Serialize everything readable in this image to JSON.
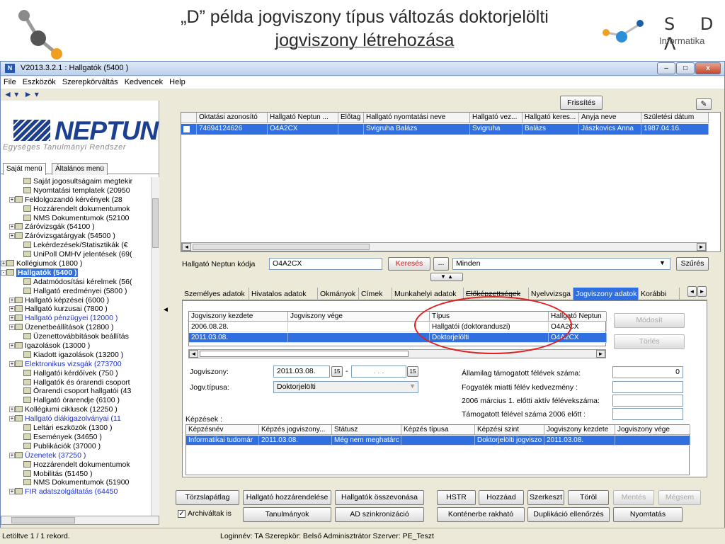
{
  "slide": {
    "title_line1": "„D” példa jogviszony típus változás doktorjelölti",
    "title_line2": "jogviszony  létrehozása",
    "brand_letters": "S D Λ",
    "brand_sub": "Informatika"
  },
  "window": {
    "title": "V2013.3.2.1 : Hallgatók (5400  )",
    "minimize": "–",
    "maximize": "□",
    "close": "x"
  },
  "menu": [
    "File",
    "Eszközök",
    "Szerepkörváltás",
    "Kedvencek",
    "Help"
  ],
  "nav": {
    "back": "◄ ▾",
    "forward": "► ▾"
  },
  "logo": {
    "name": "NEPTUN",
    "tagline": "Egységes Tanulmányi Rendszer"
  },
  "left_tabs": [
    "Saját menü",
    "Általános menü"
  ],
  "tree": [
    {
      "label": "Saját jogosultságaim megtekir",
      "indent": 2,
      "color": "black"
    },
    {
      "label": "Nyomtatási templatek (20950",
      "indent": 2,
      "color": "black"
    },
    {
      "label": "Feldolgozandó kérvények (28",
      "indent": 1,
      "color": "black"
    },
    {
      "label": "Hozzárendelt dokumentumok",
      "indent": 2,
      "color": "black"
    },
    {
      "label": "NMS Dokumentumok (52100",
      "indent": 2,
      "color": "black"
    },
    {
      "label": "Záróvizsgák (54100 )",
      "indent": 1,
      "color": "black"
    },
    {
      "label": "Záróvizsgatárgyak (54500 )",
      "indent": 1,
      "color": "black"
    },
    {
      "label": "Lekérdezések/Statisztikák (€",
      "indent": 2,
      "color": "black"
    },
    {
      "label": "UniPoll OMHV jelentések (69(",
      "indent": 2,
      "color": "black"
    },
    {
      "label": "Kollégiumok (1800 )",
      "indent": 0,
      "color": "black"
    },
    {
      "label": "Hallgatók (5400  )",
      "indent": 0,
      "color": "selected"
    },
    {
      "label": "Adatmódosítási kérelmek (56(",
      "indent": 2,
      "color": "black"
    },
    {
      "label": "Hallgató eredményei (5800 )",
      "indent": 2,
      "color": "black"
    },
    {
      "label": "Hallgató képzései (6000 )",
      "indent": 1,
      "color": "black"
    },
    {
      "label": "Hallgató kurzusai (7800 )",
      "indent": 1,
      "color": "black"
    },
    {
      "label": "Hallgató pénzügyei (12000 )",
      "indent": 1,
      "color": "blue"
    },
    {
      "label": "Üzenetbeállítások (12800 )",
      "indent": 1,
      "color": "black"
    },
    {
      "label": "Üzenettovábbítások beállítás",
      "indent": 2,
      "color": "black"
    },
    {
      "label": "Igazolások (13000 )",
      "indent": 1,
      "color": "black"
    },
    {
      "label": "Kiadott igazolások (13200 )",
      "indent": 2,
      "color": "black"
    },
    {
      "label": "Elektronikus vizsgák (273700",
      "indent": 1,
      "color": "blue"
    },
    {
      "label": "Hallgatói kérdőívek (750 )",
      "indent": 2,
      "color": "black"
    },
    {
      "label": "Hallgatók és órarendi csoport",
      "indent": 2,
      "color": "black"
    },
    {
      "label": "Órarendi csoport hallgatói (43",
      "indent": 2,
      "color": "black"
    },
    {
      "label": "Hallgató órarendje (6100 )",
      "indent": 2,
      "color": "black"
    },
    {
      "label": "Kollégiumi ciklusok (12250 )",
      "indent": 1,
      "color": "black"
    },
    {
      "label": "Hallgató diákigazolványai (11",
      "indent": 1,
      "color": "blue"
    },
    {
      "label": "Leltári eszközök (1300 )",
      "indent": 2,
      "color": "black"
    },
    {
      "label": "Események (34650 )",
      "indent": 2,
      "color": "black"
    },
    {
      "label": "Publikációk (37000 )",
      "indent": 2,
      "color": "black"
    },
    {
      "label": "Üzenetek (37250 )",
      "indent": 1,
      "color": "blue"
    },
    {
      "label": "Hozzárendelt dokumentumok",
      "indent": 2,
      "color": "black"
    },
    {
      "label": "Mobilitás (51450 )",
      "indent": 2,
      "color": "black"
    },
    {
      "label": "NMS Dokumentumok (51900",
      "indent": 2,
      "color": "black"
    },
    {
      "label": "FIR adatszolgáltatás (64450",
      "indent": 1,
      "color": "blue"
    }
  ],
  "refresh_button": "Frissítés",
  "top_grid": {
    "headers": [
      "Oktatási azonosító",
      "Hallgató Neptun ...",
      "Előtag",
      "Hallgató nyomtatási neve",
      "Hallgató vez...",
      "Hallgató keres...",
      "Anyja neve",
      "Születési dátum"
    ],
    "row": [
      "74694124626",
      "O4A2CX",
      "",
      "Svigruha Balázs",
      "Svigruha",
      "Balázs",
      "Jászkovics Anna",
      "1987.04.16."
    ]
  },
  "search": {
    "label": "Hallgató Neptun kódja",
    "value": "O4A2CX",
    "search_button": "Keresés",
    "more_button": "...",
    "filter_value": "Minden",
    "filter_button": "Szűrés"
  },
  "detail_tabs": [
    "Személyes adatok",
    "Hivatalos adatok",
    "Okmányok",
    "Címek",
    "Munkahelyi adatok",
    "Előképzettségek",
    "Nyelvvizsga",
    "Jogviszony adatok",
    "Korábbi"
  ],
  "jogviszony_grid": {
    "headers": [
      "Jogviszony kezdete",
      "Jogviszony vége",
      "Típus",
      "Hallgató Neptun"
    ],
    "rows": [
      [
        "2006.08.28.",
        "",
        "Hallgatói (doktoranduszi)",
        "O4A2CX"
      ],
      [
        "2011.03.08.",
        "",
        "Doktorjelölti",
        "O4A2CX"
      ]
    ]
  },
  "side_buttons": {
    "modify": "Módosít",
    "delete": "Törlés"
  },
  "form": {
    "jogviszony_label": "Jogviszony:",
    "jogviszony_from": "2011.03.08.",
    "jogviszony_to": ". . .",
    "date_icon": "15",
    "dash": "-",
    "type_label": "Jogv.típusa:",
    "type_value": "Doktorjelölti",
    "allami_label": "Államilag támogatott félévek száma:",
    "allami_value": "0",
    "fogyatek_label": "Fogyaték miatti félév kedvezmény :",
    "marcius_label": "2006 március 1. előtti aktív félévekszáma:",
    "tamogatott_label": "Támogatott félével száma 2006 előtt :"
  },
  "kepzesek": {
    "title": "Képzések :",
    "headers": [
      "Képzésnév",
      "Képzés jogviszony...",
      "Státusz",
      "Képzés típusa",
      "Képzési szint",
      "Jogviszony kezdete",
      "Jogviszony vége"
    ],
    "row": [
      "Informatikai tudomár",
      "2011.03.08.",
      "Még nem meghatárc",
      "",
      "Doktorjelölti jogviszo",
      "2011.03.08.",
      ""
    ]
  },
  "bottom_buttons_row1": [
    "Törzslapátlag",
    "Hallgató hozzárendelése",
    "Hallgatók összevonása",
    "HSTR",
    "Hozzáad",
    "Szerkeszt",
    "Töröl",
    "Mentés",
    "Mégsem"
  ],
  "bottom_buttons_row2": [
    "Tanulmányok",
    "AD szinkronizáció",
    "Konténerbe rakható",
    "Duplikáció ellenőrzés",
    "Nyomtatás"
  ],
  "archive_checkbox": {
    "label": "Archiváltak is",
    "checked": true
  },
  "status": {
    "left": "Letöltve 1 / 1 rekord.",
    "right": "Loginnév: TA  Szerepkör: Belső Adminisztrátor  Szerver: PE_Teszt"
  },
  "colors": {
    "selection": "#2f6fe0",
    "neptun_blue": "#1c3f8f",
    "highlight_circle": "#e02020",
    "link_blue": "#1a2fd6"
  }
}
